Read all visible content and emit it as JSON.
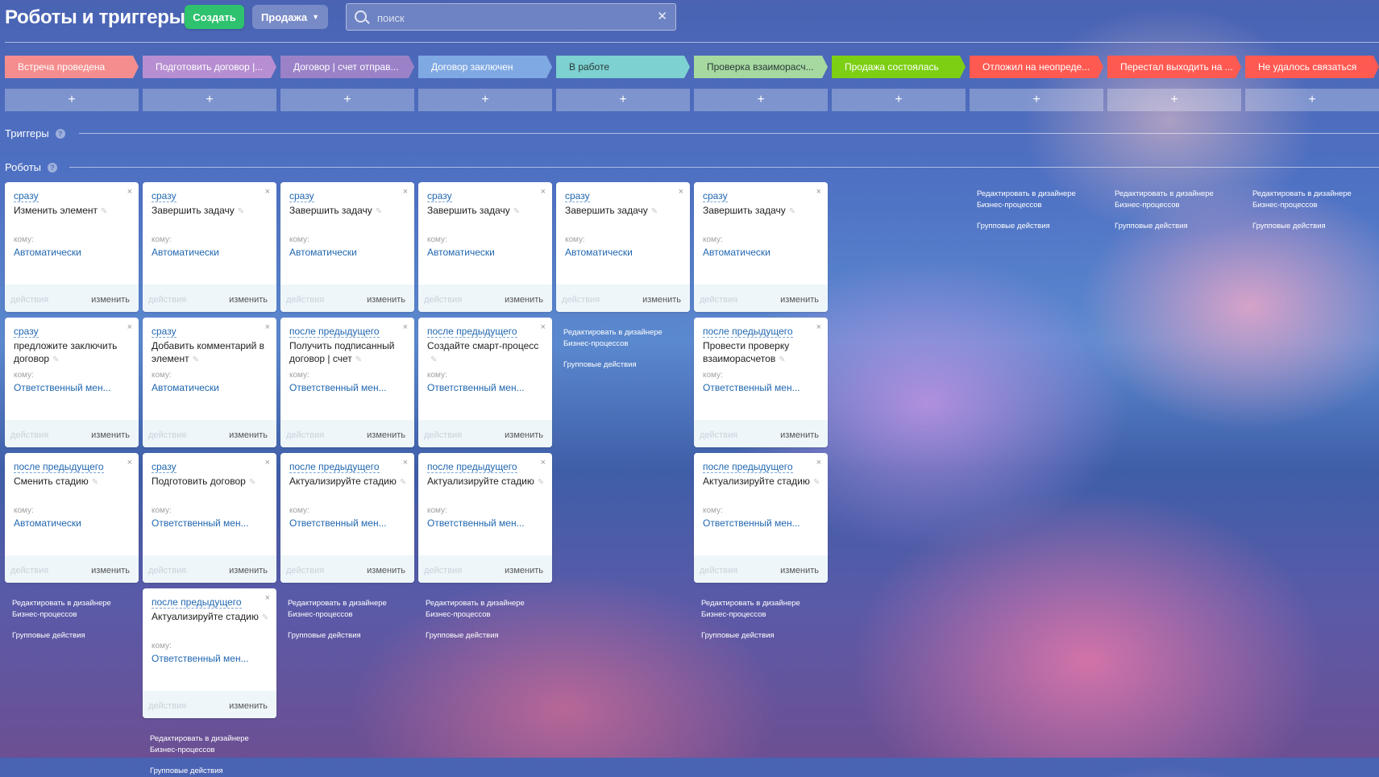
{
  "page": {
    "title": "Роботы и триггеры"
  },
  "toolbar": {
    "create_label": "Создать",
    "category_label": "Продажа",
    "search_placeholder": "поиск"
  },
  "stages": [
    {
      "label": "Встреча проведена",
      "color": "#f58d8e"
    },
    {
      "label": "Подготовить договор |...",
      "color": "#b78ed1"
    },
    {
      "label": "Договор | счет отправ...",
      "color": "#9b82c8"
    },
    {
      "label": "Договор заключен",
      "color": "#7fa9e2"
    },
    {
      "label": "В работе",
      "color": "#7dd1d0"
    },
    {
      "label": "Проверка взаиморасч...",
      "color": "#a6d9a0"
    },
    {
      "label": "Продажа состоялась",
      "color": "#7ccf13"
    },
    {
      "label": "Отложил на неопреде...",
      "color": "#ff5a52"
    },
    {
      "label": "Перестал выходить на ...",
      "color": "#ff5a52"
    },
    {
      "label": "Не удалось связаться",
      "color": "#ff5a52"
    }
  ],
  "add_label": "+",
  "sections": {
    "triggers": "Триггеры",
    "robots": "Роботы",
    "help": "?"
  },
  "card_labels": {
    "to": "кому:",
    "actions": "действия",
    "edit": "изменить",
    "close": "×"
  },
  "column_links": {
    "bp_editor": "Редактировать в дизайнере Бизнес-процессов",
    "group_actions": "Групповые действия"
  },
  "columns": [
    {
      "robots": [
        {
          "delay": "сразу",
          "name": "Изменить элемент",
          "assignee": "Автоматически"
        },
        {
          "delay": "сразу",
          "name": "предложите заключить договор",
          "assignee": "Ответственный мен..."
        },
        {
          "delay": "после предыдущего",
          "name": "Сменить стадию",
          "assignee": "Автоматически"
        }
      ]
    },
    {
      "robots": [
        {
          "delay": "сразу",
          "name": "Завершить задачу",
          "assignee": "Автоматически"
        },
        {
          "delay": "сразу",
          "name": "Добавить комментарий в элемент",
          "assignee": "Автоматически"
        },
        {
          "delay": "сразу",
          "name": "Подготовить договор",
          "assignee": "Ответственный мен..."
        },
        {
          "delay": "после предыдущего",
          "name": "Актуализируйте стадию",
          "assignee": "Ответственный мен..."
        }
      ]
    },
    {
      "robots": [
        {
          "delay": "сразу",
          "name": "Завершить задачу",
          "assignee": "Автоматически"
        },
        {
          "delay": "после предыдущего",
          "name": "Получить подписанный договор | счет",
          "assignee": "Ответственный мен..."
        },
        {
          "delay": "после предыдущего",
          "name": "Актуализируйте стадию",
          "assignee": "Ответственный мен..."
        }
      ]
    },
    {
      "robots": [
        {
          "delay": "сразу",
          "name": "Завершить задачу",
          "assignee": "Автоматически"
        },
        {
          "delay": "после предыдущего",
          "name": "Создайте смарт-процесс",
          "assignee": "Ответственный мен..."
        },
        {
          "delay": "после предыдущего",
          "name": "Актуализируйте стадию",
          "assignee": "Ответственный мен..."
        }
      ]
    },
    {
      "robots": [
        {
          "delay": "сразу",
          "name": "Завершить задачу",
          "assignee": "Автоматически"
        }
      ]
    },
    {
      "robots": [
        {
          "delay": "сразу",
          "name": "Завершить задачу",
          "assignee": "Автоматически"
        },
        {
          "delay": "после предыдущего",
          "name": "Провести проверку взаиморасчетов",
          "assignee": "Ответственный мен..."
        },
        {
          "delay": "после предыдущего",
          "name": "Актуализируйте стадию",
          "assignee": "Ответственный мен..."
        }
      ]
    },
    {
      "robots": []
    },
    {
      "robots": []
    },
    {
      "robots": []
    },
    {
      "robots": []
    }
  ]
}
